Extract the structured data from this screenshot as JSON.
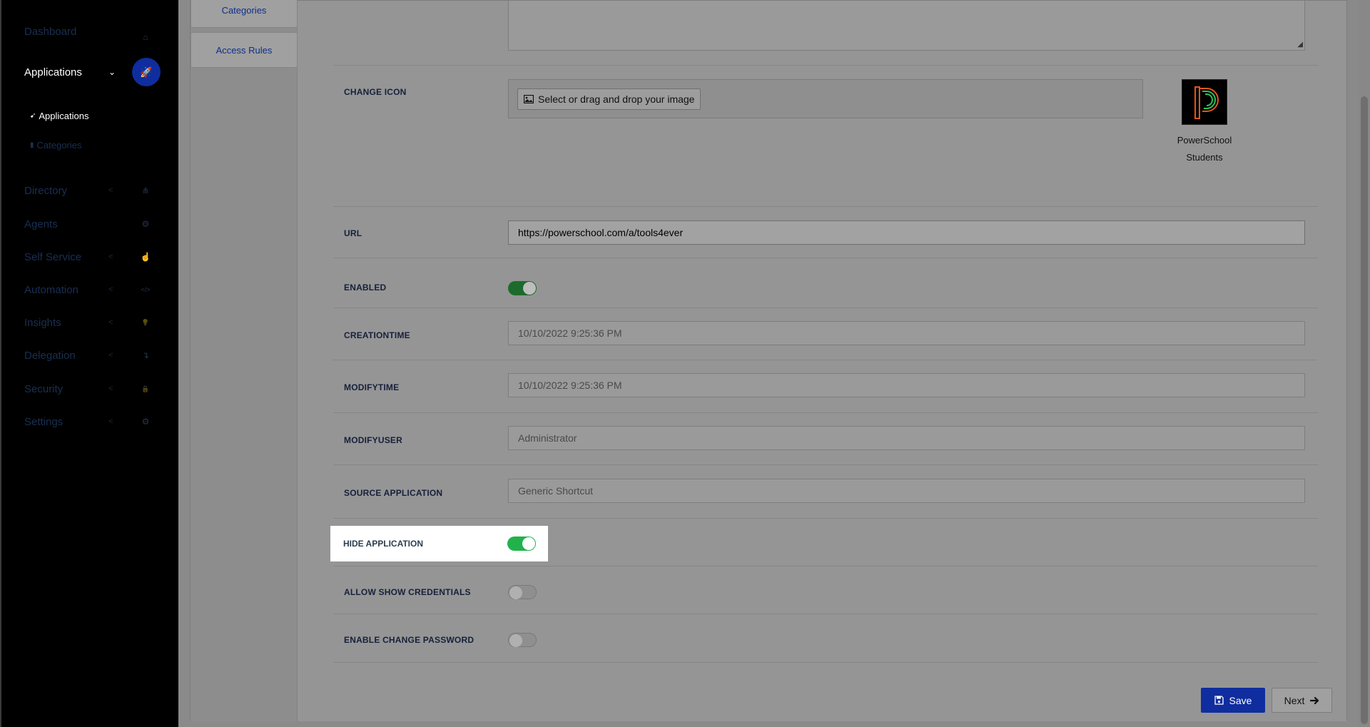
{
  "sidebar": {
    "items": [
      {
        "label": "Dashboard",
        "icon": "home-icon",
        "glyph": "⌂"
      },
      {
        "label": "Applications",
        "icon": "rocket-icon",
        "glyph": "🚀"
      },
      {
        "label": "Directory",
        "icon": "sitemap-icon",
        "glyph": "⋔"
      },
      {
        "label": "Agents",
        "icon": "users-cog-icon",
        "glyph": "⚙"
      },
      {
        "label": "Self Service",
        "icon": "hand-pointer-icon",
        "glyph": "☝"
      },
      {
        "label": "Automation",
        "icon": "code-icon",
        "glyph": "</>"
      },
      {
        "label": "Insights",
        "icon": "lightbulb-icon",
        "glyph": "💡"
      },
      {
        "label": "Delegation",
        "icon": "level-down-icon",
        "glyph": "↴"
      },
      {
        "label": "Security",
        "icon": "lock-icon",
        "glyph": "🔒"
      },
      {
        "label": "Settings",
        "icon": "gear-icon",
        "glyph": "⚙"
      }
    ],
    "sub_items": [
      {
        "label": "Applications",
        "icon": "rocket-icon",
        "glyph": "🚀"
      },
      {
        "label": "Categories",
        "icon": "bookmark-icon",
        "glyph": "🔖"
      }
    ]
  },
  "tabs": [
    "Categories",
    "Access Rules"
  ],
  "form": {
    "change_icon_label": "CHANGE ICON",
    "upload_button": "Select or drag and drop your image",
    "app_name_line1": "PowerSchool",
    "app_name_line2": "Students",
    "url_label": "URL",
    "url_value": "https://powerschool.com/a/tools4ever",
    "enabled_label": "ENABLED",
    "enabled": true,
    "creationtime_label": "CREATIONTIME",
    "creationtime_value": "10/10/2022 9:25:36 PM",
    "modifytime_label": "MODIFYTIME",
    "modifytime_value": "10/10/2022 9:25:36 PM",
    "modifyuser_label": "MODIFYUSER",
    "modifyuser_value": "Administrator",
    "source_label": "SOURCE APPLICATION",
    "source_value": "Generic Shortcut",
    "hide_label": "HIDE APPLICATION",
    "hide": true,
    "allow_show_label": "ALLOW SHOW CREDENTIALS",
    "allow_show": false,
    "change_pw_label": "ENABLE CHANGE PASSWORD",
    "change_pw": false
  },
  "buttons": {
    "save": "Save",
    "next": "Next"
  },
  "colors": {
    "accent": "#0f2d9e",
    "toggle_on": "#22b24c"
  }
}
